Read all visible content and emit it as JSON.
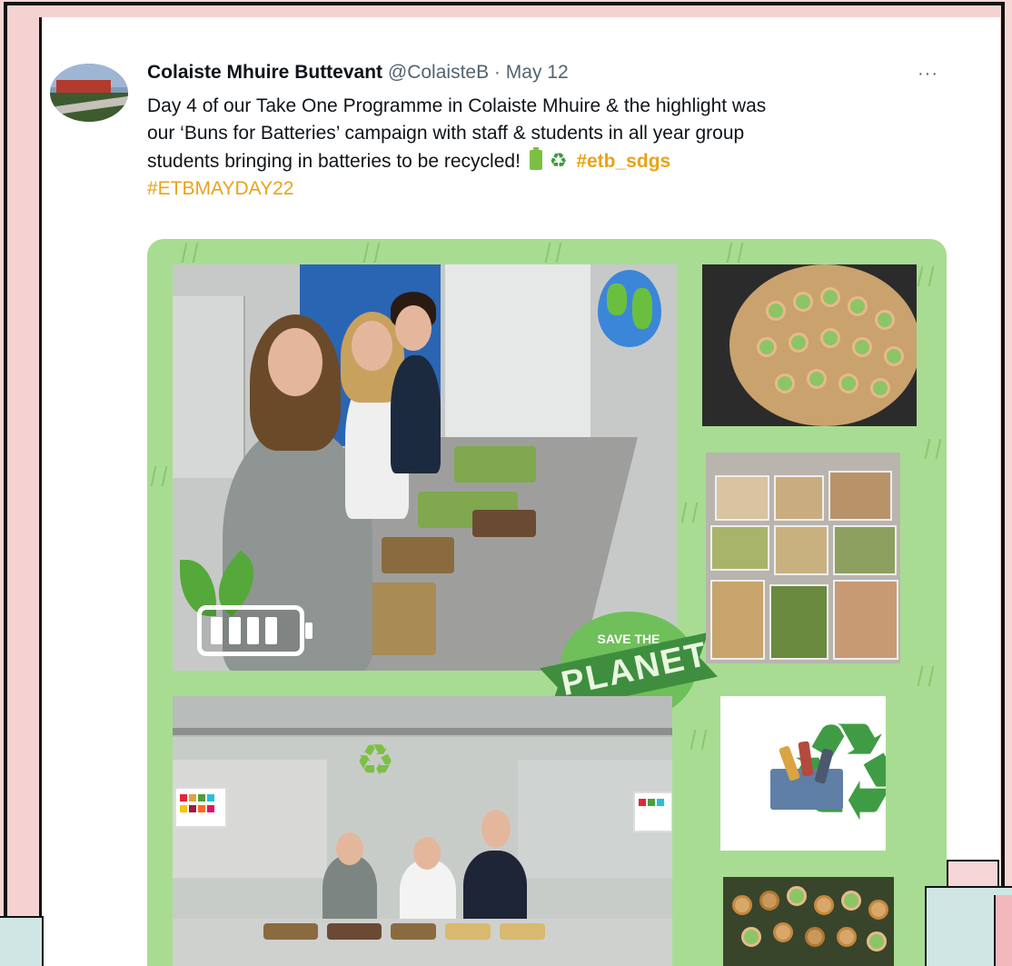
{
  "tweet": {
    "author_name": "Colaiste Mhuire Buttevant",
    "handle": "@ColaisteB",
    "separator": " · ",
    "date": "May 12",
    "more_label": "···",
    "text_line1": "Day 4 of our Take One Programme in Colaiste Mhuire & the highlight was",
    "text_line2": "our ‘Buns for Batteries’ campaign with staff & students in all year group",
    "text_line3": "students bringing in batteries to be recycled!",
    "hashtag1": "#etb_sdgs",
    "hashtag2": "#ETBMAYDAY22",
    "emoji_battery": "battery-emoji",
    "emoji_recycle": "recycle-emoji"
  },
  "media": {
    "badge_small": "SAVE THE",
    "badge_big": "PLANET",
    "colors": {
      "background_green": "#a8dc92",
      "hashtag": "#e8a317"
    }
  }
}
